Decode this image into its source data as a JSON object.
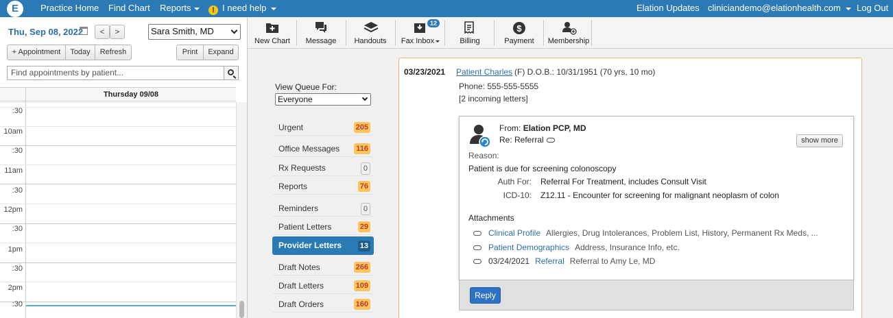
{
  "topnav": {
    "logo": "E",
    "practice_home": "Practice Home",
    "find_chart": "Find Chart",
    "reports": "Reports",
    "warn_glyph": "!",
    "need_help": "I need help",
    "updates": "Elation Updates",
    "user": "cliniciandemo@elationhealth.com",
    "logout": "Log Out"
  },
  "scheduler": {
    "date": "Thu, Sep 08, 2022",
    "prev": "<",
    "next": ">",
    "provider": "Sara Smith, MD",
    "appointment_btn": "+ Appointment",
    "today_btn": "Today",
    "refresh_btn": "Refresh",
    "print_btn": "Print",
    "expand_btn": "Expand",
    "search_placeholder": "Find appointments by patient...",
    "day_header": "Thursday 09/08",
    "slots": [
      ":30",
      "10am",
      ":30",
      "11am",
      ":30",
      "12pm",
      ":30",
      "1pm",
      ":30",
      "2pm",
      ":30"
    ]
  },
  "toolbar": {
    "new_chart": "New Chart",
    "message": "Message",
    "handouts": "Handouts",
    "fax_inbox": "Fax Inbox",
    "fax_count": "12",
    "billing": "Billing",
    "payment": "Payment",
    "membership": "Membership"
  },
  "queue": {
    "label": "View Queue For:",
    "selected": "Everyone",
    "items": [
      {
        "label": "Urgent",
        "count": "205"
      },
      {
        "label": "Office Messages",
        "count": "116"
      },
      {
        "label": "Rx Requests",
        "count": "0"
      },
      {
        "label": "Reports",
        "count": "76"
      },
      {
        "label": "Reminders",
        "count": "0"
      },
      {
        "label": "Patient Letters",
        "count": "29"
      },
      {
        "label": "Provider Letters",
        "count": "13"
      },
      {
        "label": "Draft Notes",
        "count": "266"
      },
      {
        "label": "Draft Letters",
        "count": "109"
      },
      {
        "label": "Draft Orders",
        "count": "160"
      }
    ]
  },
  "letter": {
    "date": "03/23/2021",
    "patient_name": "Patient Charles",
    "patient_info": "(F)  D.O.B.: 10/31/1951 (70 yrs, 10 mo)",
    "phone": "Phone: 555-555-5555",
    "incoming": "[2 incoming letters]",
    "from_label": "From:",
    "from_name": "Elation PCP, MD",
    "re_text": "Re: Referral",
    "show_more": "show more",
    "reason_label": "Reason:",
    "reason": "Patient is due for screening colonoscopy",
    "auth_label": "Auth For:",
    "auth_value": "Referral For Treatment, includes Consult Visit",
    "icd_label": "ICD-10:",
    "icd_value": "Z12.11 - Encounter for screening for malignant neoplasm of colon",
    "attachments_label": "Attachments",
    "attachments": [
      {
        "date": "",
        "link": "Clinical Profile",
        "desc": "Allergies, Drug Intolerances, Problem List, History, Permanent Rx Meds, ..."
      },
      {
        "date": "",
        "link": "Patient Demographics",
        "desc": "Address, Insurance Info, etc."
      },
      {
        "date": "03/24/2021",
        "link": "Referral",
        "desc": "Referral to Amy Le, MD"
      }
    ],
    "reply": "Reply"
  }
}
